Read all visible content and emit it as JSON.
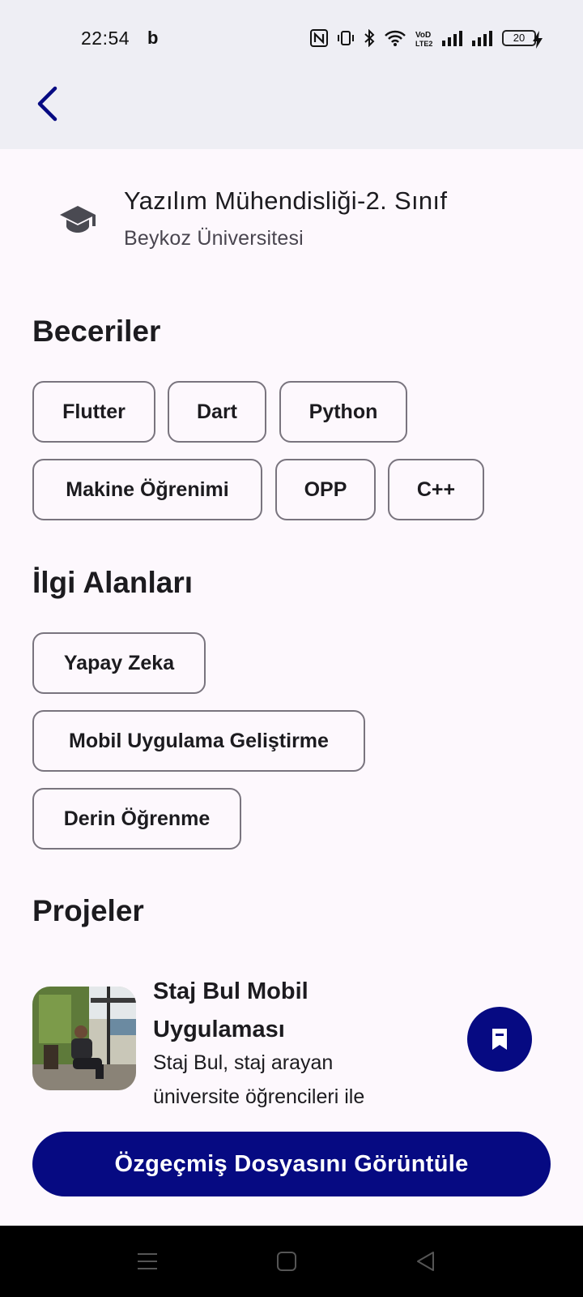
{
  "status": {
    "time": "22:54",
    "carrier_glyph": "b",
    "battery_level": "20",
    "lte_label": "VoLTE"
  },
  "app_bar": {
    "back_icon": "chevron-left-icon"
  },
  "education": {
    "icon": "graduation-cap-icon",
    "title": "Yazılım Mühendisliği-2. Sınıf",
    "school": "Beykoz Üniversitesi"
  },
  "skills": {
    "title": "Beceriler",
    "items": [
      "Flutter",
      "Dart",
      "Python",
      "Makine Öğrenimi",
      "OPP",
      "C++"
    ]
  },
  "interests": {
    "title": "İlgi Alanları",
    "items": [
      "Yapay Zeka",
      "Mobil Uygulama Geliştirme",
      "Derin Öğrenme"
    ]
  },
  "projects": {
    "title": "Projeler",
    "items": [
      {
        "title": "Staj Bul Mobil Uygulaması",
        "description": "Staj Bul, staj arayan üniversite öğrencileri ile"
      }
    ]
  },
  "fab": {
    "icon": "bookmark-icon"
  },
  "cv_button": {
    "label": "Özgeçmiş Dosyasını Görüntüle"
  },
  "colors": {
    "primary": "#060a82",
    "app_bar_bg": "#eeeef4",
    "page_bg": "#fdf8fd",
    "chip_border": "#79747e"
  }
}
